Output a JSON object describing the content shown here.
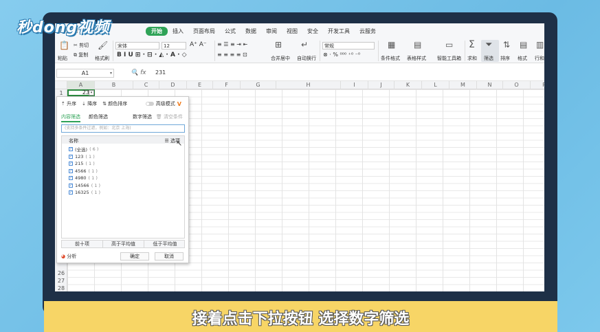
{
  "logo": "秒dong视频",
  "menubar": {
    "quick_icons": "▤ ⎙ ◫ ↶ ↷ ▿",
    "items": [
      "开始",
      "插入",
      "页面布局",
      "公式",
      "数据",
      "审阅",
      "视图",
      "安全",
      "开发工具",
      "云服务"
    ]
  },
  "ribbon": {
    "cut": "剪切",
    "paste": "粘贴",
    "copy": "复制",
    "format_painter": "格式刷",
    "font": "宋体",
    "size": "12",
    "number_format": "常规",
    "merge": "合并居中",
    "wrap": "自动换行",
    "conditional": "条件格式",
    "table_style": "表格样式",
    "smart_tools": "智能工具箱",
    "sum": "求和",
    "filter": "筛选",
    "sort": "排序",
    "format": "格式",
    "rowcol": "行和"
  },
  "formula_bar": {
    "namebox": "A1",
    "fx_icons": "🔍 fx",
    "value": "231"
  },
  "columns": [
    "A",
    "B",
    "C",
    "D",
    "E",
    "F",
    "G",
    "H",
    "I",
    "J",
    "K",
    "L",
    "M",
    "N",
    "O",
    "P"
  ],
  "rows": {
    "r1": "1",
    "r26": "26",
    "r27": "27",
    "r28": "28"
  },
  "cell_a1": "23",
  "popup": {
    "sort_asc": "升序",
    "sort_desc": "降序",
    "sort_color": "颜色排序",
    "advanced": "高级模式",
    "vip": "V",
    "tab_content": "内容筛选",
    "tab_color": "颜色筛选",
    "tab_number": "数字筛选",
    "clear": "清空条件",
    "search_placeholder": "(支持多条件过滤，例如：北京 上海)",
    "list_header_name": "名称",
    "list_header_options": "☰ 选项",
    "items": [
      {
        "label": "(全选)",
        "count": "( 6 )"
      },
      {
        "label": "123",
        "count": "( 1 )"
      },
      {
        "label": "215",
        "count": "( 1 )"
      },
      {
        "label": "4566",
        "count": "( 1 )"
      },
      {
        "label": "4980",
        "count": "( 1 )"
      },
      {
        "label": "14566",
        "count": "( 1 )"
      },
      {
        "label": "16325",
        "count": "( 1 )"
      }
    ],
    "top10": "前十项",
    "above_avg": "高于平均值",
    "below_avg": "低于平均值",
    "analyze": "分析",
    "ok": "确定",
    "cancel": "取消"
  },
  "subtitle": "接着点击下拉按钮 选择数字筛选"
}
